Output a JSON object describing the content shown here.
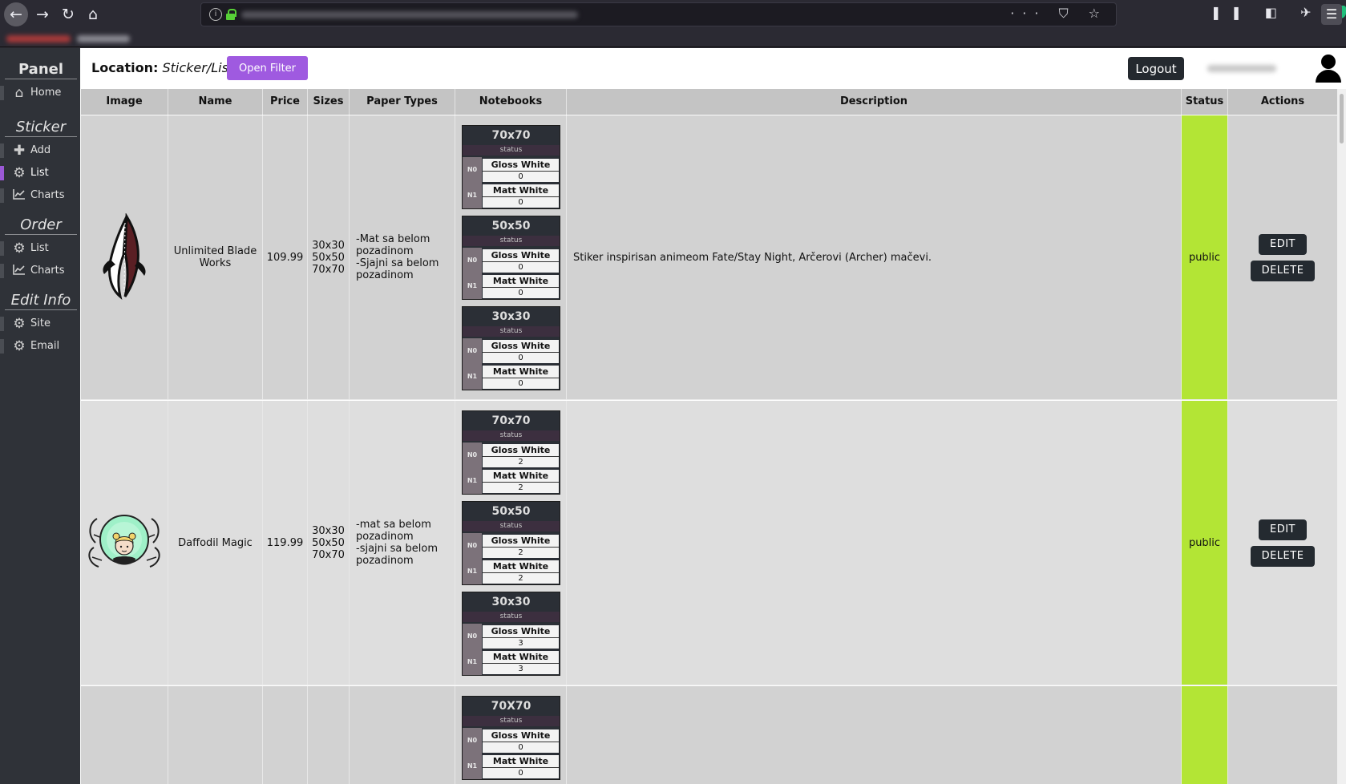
{
  "browser": {
    "menu_icons": "··· ⛉ ☆"
  },
  "sidebar": {
    "panel_title": "Panel",
    "home_label": "Home",
    "sticker_section": "Sticker",
    "sticker_add": "Add",
    "sticker_list": "List",
    "sticker_charts": "Charts",
    "order_section": "Order",
    "order_list": "List",
    "order_charts": "Charts",
    "edit_section": "Edit Info",
    "edit_site": "Site",
    "edit_email": "Email"
  },
  "header": {
    "location_label": "Location:",
    "location_value": "Sticker/List",
    "filter_button": "Open Filter",
    "logout_button": "Logout"
  },
  "table": {
    "columns": [
      "Image",
      "Name",
      "Price",
      "Sizes",
      "Paper Types",
      "Notebooks",
      "Description",
      "Status",
      "Actions"
    ],
    "edit_label": "EDIT",
    "delete_label": "DELETE",
    "status_caption": "status",
    "rows": [
      {
        "name": "Unlimited Blade Works",
        "price": "109.99",
        "sizes": "30x30\n50x50\n70x70",
        "paper_types": "-Mat sa belom\npozadinom\n-Sjajni sa belom\npozadinom",
        "description": "Stiker inspirisan animeom Fate/Stay Night, Arčerovi (Archer) mačevi.",
        "status": "public",
        "notebooks": [
          {
            "size": "70x70",
            "lines": [
              {
                "tag": "N0",
                "paper": "Gloss White",
                "qty": "0"
              },
              {
                "tag": "N1",
                "paper": "Matt White",
                "qty": "0"
              }
            ]
          },
          {
            "size": "50x50",
            "lines": [
              {
                "tag": "N0",
                "paper": "Gloss White",
                "qty": "0"
              },
              {
                "tag": "N1",
                "paper": "Matt White",
                "qty": "0"
              }
            ]
          },
          {
            "size": "30x30",
            "lines": [
              {
                "tag": "N0",
                "paper": "Gloss White",
                "qty": "0"
              },
              {
                "tag": "N1",
                "paper": "Matt White",
                "qty": "0"
              }
            ]
          }
        ]
      },
      {
        "name": "Daffodil Magic",
        "price": "119.99",
        "sizes": "30x30\n50x50\n70x70",
        "paper_types": "-mat sa belom\npozadinom\n-sjajni sa belom\npozadinom",
        "description": "",
        "status": "public",
        "notebooks": [
          {
            "size": "70x70",
            "lines": [
              {
                "tag": "N0",
                "paper": "Gloss White",
                "qty": "2"
              },
              {
                "tag": "N1",
                "paper": "Matt White",
                "qty": "2"
              }
            ]
          },
          {
            "size": "50x50",
            "lines": [
              {
                "tag": "N0",
                "paper": "Gloss White",
                "qty": "2"
              },
              {
                "tag": "N1",
                "paper": "Matt White",
                "qty": "2"
              }
            ]
          },
          {
            "size": "30x30",
            "lines": [
              {
                "tag": "N0",
                "paper": "Gloss White",
                "qty": "3"
              },
              {
                "tag": "N1",
                "paper": "Matt White",
                "qty": "3"
              }
            ]
          }
        ]
      },
      {
        "name": "",
        "price": "",
        "sizes": "",
        "paper_types": "",
        "description": "",
        "status": "",
        "notebooks": [
          {
            "size": "70X70",
            "lines": [
              {
                "tag": "N0",
                "paper": "Gloss White",
                "qty": "0"
              },
              {
                "tag": "N1",
                "paper": "Matt White",
                "qty": "0"
              }
            ]
          }
        ]
      }
    ]
  },
  "colors": {
    "accent_purple": "#9f5ae0",
    "status_public": "#b3e535",
    "sidebar_bg": "#2f3238",
    "dark_button": "#242a30"
  },
  "icons": {
    "home": "home-icon",
    "add": "plus-icon",
    "list": "gear-icon",
    "charts": "line-chart-icon",
    "user": "user-icon"
  }
}
